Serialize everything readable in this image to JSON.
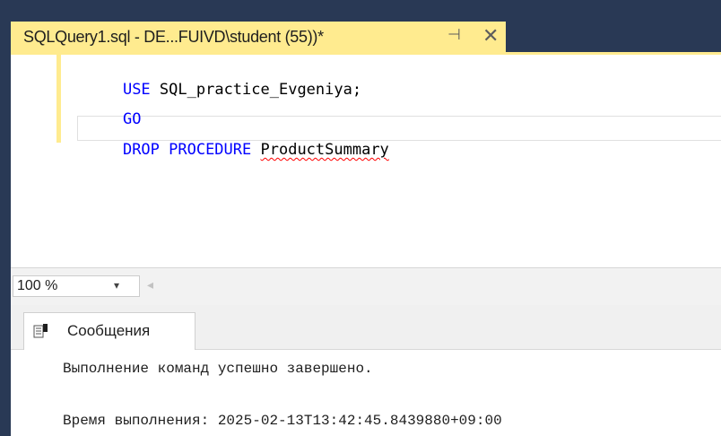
{
  "document_tab": {
    "title": "SQLQuery1.sql - DE...FUIVD\\student (55))*",
    "pin_glyph": "⊣",
    "close_glyph": "✕"
  },
  "editor": {
    "lines": [
      {
        "keyword": "USE",
        "identifier": "SQL_practice_Evgeniya;"
      },
      {
        "keyword": "GO",
        "identifier": ""
      },
      {
        "keyword": "DROP PROCEDURE",
        "identifier": "ProductSummary"
      }
    ]
  },
  "zoom": {
    "value": "100 %",
    "dropdown_glyph": "▾",
    "scroll_glyph": "◂"
  },
  "results": {
    "tab_label": "Сообщения",
    "messages": [
      "Выполнение команд успешно завершено.",
      "Время выполнения: 2025-02-13T13:42:45.8439880+09:00"
    ]
  },
  "colors": {
    "tab_active": "#ffeb8f",
    "frame": "#293955",
    "keyword": "#0000ff",
    "error_squiggle": "#ff0000"
  }
}
